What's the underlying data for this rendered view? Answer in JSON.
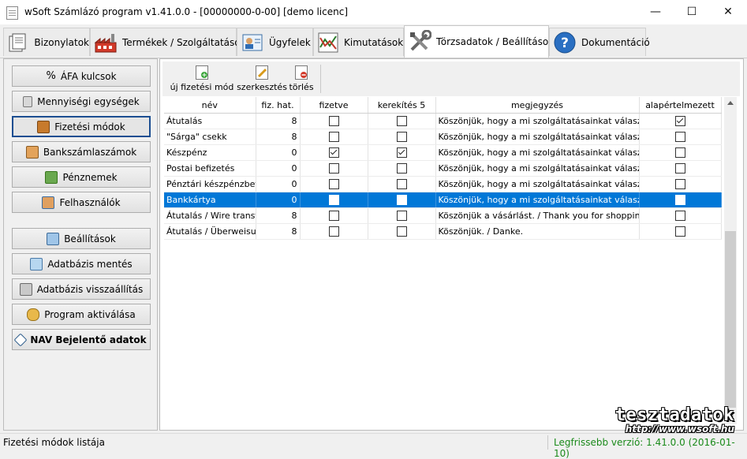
{
  "window": {
    "title": "wSoft Számlázó program v1.41.0.0 - [00000000-0-00] [demo licenc]",
    "minimize": "—",
    "maximize": "☐",
    "close": "✕"
  },
  "tabs": [
    {
      "label": "Bizonylatok",
      "icon": "documents-icon"
    },
    {
      "label": "Termékek / Szolgáltatások",
      "icon": "factory-icon"
    },
    {
      "label": "Ügyfelek",
      "icon": "contact-card-icon"
    },
    {
      "label": "Kimutatások",
      "icon": "chart-icon"
    },
    {
      "label": "Törzsadatok / Beállítások",
      "icon": "tools-icon",
      "active": true
    },
    {
      "label": "Dokumentáció",
      "icon": "help-icon"
    }
  ],
  "sidebar": {
    "items": [
      {
        "label": "ÁFA kulcsok",
        "icon": "percent-icon"
      },
      {
        "label": "Mennyiségi egységek",
        "icon": "scale-icon"
      },
      {
        "label": "Fizetési módok",
        "icon": "payment-icon",
        "active": true
      },
      {
        "label": "Bankszámlaszámok",
        "icon": "bank-icon"
      },
      {
        "label": "Pénznemek",
        "icon": "currency-icon"
      },
      {
        "label": "Felhasználók",
        "icon": "users-icon"
      },
      {
        "label": "Beállítások",
        "icon": "settings-icon"
      },
      {
        "label": "Adatbázis mentés",
        "icon": "database-save-icon"
      },
      {
        "label": "Adatbázis visszaállítás",
        "icon": "database-restore-icon"
      },
      {
        "label": "Program aktiválása",
        "icon": "key-icon"
      },
      {
        "label": "NAV Bejelentő adatok",
        "icon": "nav-icon",
        "bold": true
      }
    ]
  },
  "toolbar": {
    "new_label": "új fizetési mód",
    "edit_label": "szerkesztés",
    "delete_label": "törlés"
  },
  "grid": {
    "columns": [
      "név",
      "fiz. hat.",
      "fizetve",
      "kerekítés 5",
      "megjegyzés",
      "alapértelmezett"
    ],
    "rows": [
      {
        "name": "Átutalás",
        "days": "8",
        "paid": false,
        "round5": false,
        "note": "Köszönjük, hogy a mi szolgáltatásainkat választotta",
        "default": true
      },
      {
        "name": "\"Sárga\" csekk",
        "days": "8",
        "paid": false,
        "round5": false,
        "note": "Köszönjük, hogy a mi szolgáltatásainkat választotta",
        "default": false
      },
      {
        "name": "Készpénz",
        "days": "0",
        "paid": true,
        "round5": true,
        "note": "Köszönjük, hogy a mi szolgáltatásainkat választotta",
        "default": false
      },
      {
        "name": "Postai befizetés",
        "days": "0",
        "paid": false,
        "round5": false,
        "note": "Köszönjük, hogy a mi szolgáltatásainkat választotta",
        "default": false
      },
      {
        "name": "Pénztári készpénzbefizetés",
        "days": "0",
        "paid": false,
        "round5": false,
        "note": "Köszönjük, hogy a mi szolgáltatásainkat választotta",
        "default": false
      },
      {
        "name": "Bankkártya",
        "days": "0",
        "paid": false,
        "round5": false,
        "note": "Köszönjük, hogy a mi szolgáltatásainkat választotta",
        "default": false,
        "selected": true
      },
      {
        "name": "Átutalás / Wire transfer",
        "days": "8",
        "paid": false,
        "round5": false,
        "note": "Köszönjük a vásárlást. / Thank you for shopping",
        "default": false
      },
      {
        "name": "Átutalás / Überweisung",
        "days": "8",
        "paid": false,
        "round5": false,
        "note": "Köszönjük. / Danke.",
        "default": false
      }
    ]
  },
  "watermark": {
    "line1": "tesztadatok",
    "line2": "http://www.wsoft.hu"
  },
  "status": {
    "left": "Fizetési módok listája",
    "right": "Legfrissebb verzió: 1.41.0.0 (2016-01-10)"
  }
}
